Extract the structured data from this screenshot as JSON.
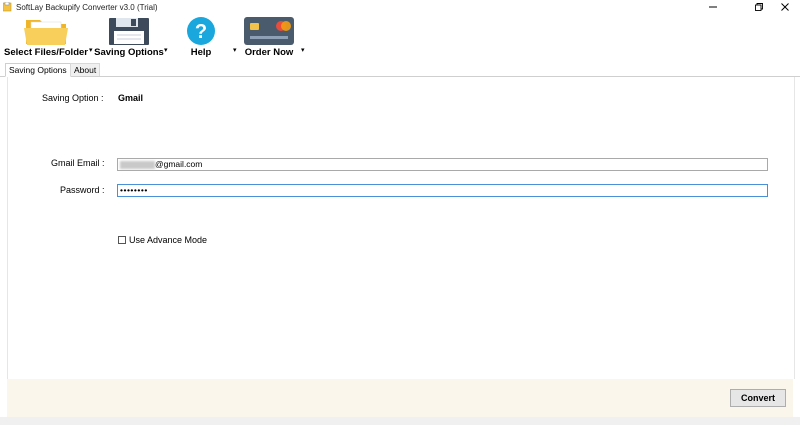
{
  "window": {
    "title": "SoftLay Backupify Converter v3.0 (Trial)",
    "controls": [
      "minimize-icon",
      "restore-icon",
      "close-icon"
    ]
  },
  "toolbar": {
    "select_files_label": "Select Files/Folder",
    "saving_options_label": "Saving Options",
    "help_label": "Help",
    "order_now_label": "Order Now",
    "dropdown_glyph": "▾"
  },
  "tabs": [
    {
      "label": "Saving Options",
      "active": true
    },
    {
      "label": "About",
      "active": false
    }
  ],
  "form": {
    "saving_option_label": "Saving Option :",
    "saving_option_value": "Gmail",
    "gmail_email_label": "Gmail Email :",
    "gmail_email_value_suffix": "@gmail.com",
    "password_label": "Password :",
    "password_value": "••••••••",
    "advance_mode_label": "Use Advance Mode",
    "advance_mode_checked": false
  },
  "footer": {
    "convert_label": "Convert"
  },
  "colors": {
    "folder": "#f5c242",
    "help_circle": "#1aa7dd",
    "card": "#4b5b6e",
    "footer_bg": "#fbf6ec",
    "focus_border": "#4a90d9"
  }
}
